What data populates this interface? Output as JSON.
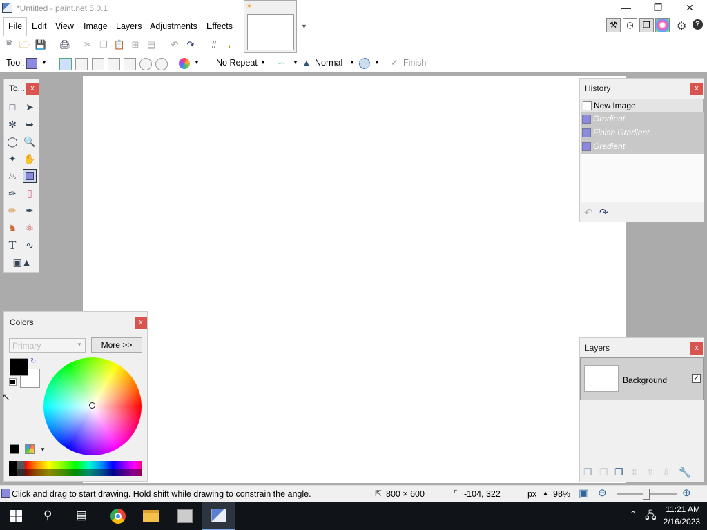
{
  "window": {
    "title": "*Untitled - paint.net 5.0.1"
  },
  "menu": {
    "items": [
      "File",
      "Edit",
      "View",
      "Image",
      "Layers",
      "Adjustments",
      "Effects"
    ]
  },
  "toolbar": {
    "tool_label": "Tool:",
    "repeat_mode": "No Repeat",
    "blend_mode": "Normal",
    "finish_label": "Finish"
  },
  "tools_panel": {
    "title": "To..."
  },
  "history": {
    "title": "History",
    "items": [
      "New Image",
      "Gradient",
      "Finish Gradient",
      "Gradient"
    ]
  },
  "colors_panel": {
    "title": "Colors",
    "mode_placeholder": "Primary",
    "more_button": "More >>"
  },
  "layers": {
    "title": "Layers",
    "items": [
      {
        "name": "Background",
        "visible": true
      }
    ]
  },
  "status": {
    "hint": "Click and drag to start drawing. Hold shift while drawing to constrain the angle.",
    "image_size": "800 × 600",
    "cursor_pos": "-104, 322",
    "units": "px",
    "zoom": "98%"
  },
  "taskbar": {
    "time": "11:21 AM",
    "date": "2/16/2023"
  },
  "colors": {
    "accent": "#d9534f",
    "gradient_icon": "#8a8ae0"
  }
}
